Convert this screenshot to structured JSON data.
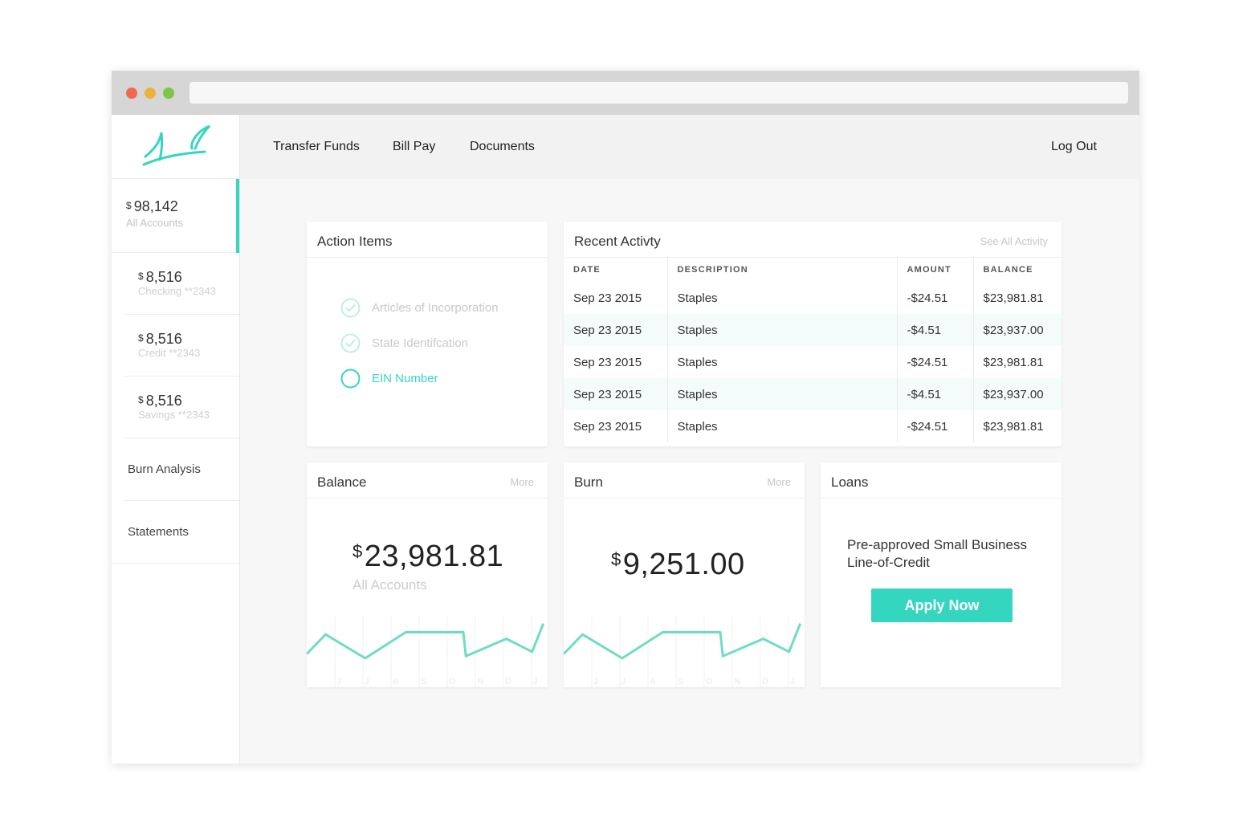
{
  "nav": {
    "transfer_funds": "Transfer Funds",
    "bill_pay": "Bill Pay",
    "documents": "Documents",
    "log_out": "Log Out"
  },
  "sidebar": {
    "all_accounts": {
      "currency": "$",
      "amount": "98,142",
      "label": "All Accounts"
    },
    "accounts": [
      {
        "currency": "$",
        "amount": "8,516",
        "label": "Checking **2343"
      },
      {
        "currency": "$",
        "amount": "8,516",
        "label": "Credit **2343"
      },
      {
        "currency": "$",
        "amount": "8,516",
        "label": "Savings **2343"
      }
    ],
    "links": [
      "Burn Analysis",
      "Statements"
    ]
  },
  "action_items": {
    "title": "Action Items",
    "items": [
      {
        "label": "Articles of Incorporation",
        "status": "done"
      },
      {
        "label": "State Identifcation",
        "status": "done"
      },
      {
        "label": "EIN Number",
        "status": "pending"
      }
    ]
  },
  "recent_activity": {
    "title": "Recent Activty",
    "see_all": "See All Activity",
    "columns": [
      "DATE",
      "DESCRIPTION",
      "AMOUNT",
      "BALANCE"
    ],
    "rows": [
      [
        "Sep 23 2015",
        "Staples",
        "-$24.51",
        "$23,981.81"
      ],
      [
        "Sep 23 2015",
        "Staples",
        "-$4.51",
        "$23,937.00"
      ],
      [
        "Sep 23 2015",
        "Staples",
        "-$24.51",
        "$23,981.81"
      ],
      [
        "Sep 23 2015",
        "Staples",
        "-$4.51",
        "$23,937.00"
      ],
      [
        "Sep 23 2015",
        "Staples",
        "-$24.51",
        "$23,981.81"
      ]
    ]
  },
  "balance": {
    "title": "Balance",
    "more": "More",
    "currency": "$",
    "amount": "23,981.81",
    "label": "All Accounts"
  },
  "burn": {
    "title": "Burn",
    "more": "More",
    "currency": "$",
    "amount": "9,251.00"
  },
  "loans": {
    "title": "Loans",
    "text": "Pre-approved Small Business Line-of-Credit",
    "button": "Apply Now"
  },
  "colors": {
    "accent": "#35d6bf",
    "line": "#6fdcc4",
    "pending_text": "#35d6bf",
    "done_text": "#c9c9c9"
  },
  "chart_data": [
    {
      "type": "line",
      "categories": [
        "J",
        "J",
        "A",
        "S",
        "O",
        "N",
        "D",
        "J"
      ],
      "values": [
        0.5,
        1.4,
        0.3,
        1.5,
        1.5,
        0.4,
        1.2,
        0.6,
        1.9
      ]
    },
    {
      "type": "line",
      "categories": [
        "J",
        "J",
        "A",
        "S",
        "O",
        "N",
        "D",
        "J"
      ],
      "values": [
        0.5,
        1.4,
        0.3,
        1.5,
        1.5,
        0.4,
        1.2,
        0.6,
        1.9
      ]
    }
  ]
}
